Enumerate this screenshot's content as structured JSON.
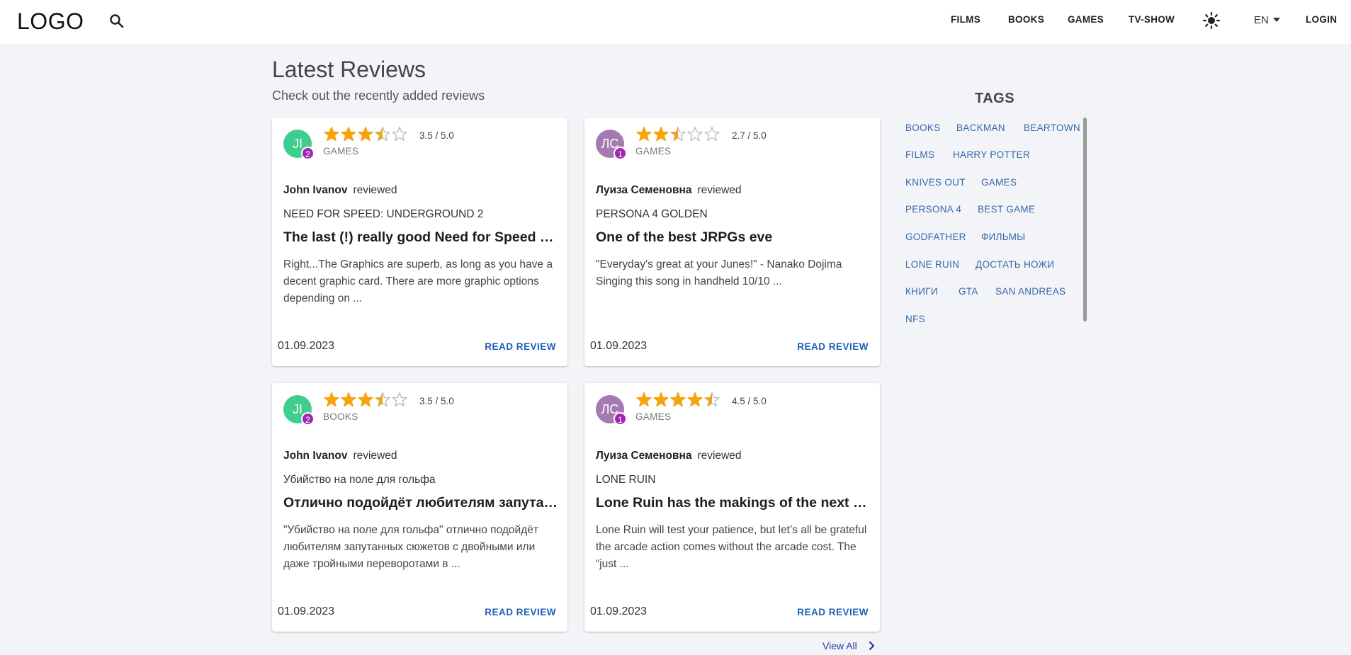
{
  "header": {
    "logo": "LOGO",
    "nav": [
      "FILMS",
      "BOOKS",
      "GAMES",
      "TV-SHOW"
    ],
    "lang": "EN",
    "login": "LOGIN"
  },
  "main": {
    "title": "Latest Reviews",
    "subtitle": "Check out the recently added reviews",
    "reviewed_word": "reviewed",
    "read_review_label": "READ REVIEW",
    "view_all": "View All"
  },
  "reviews": [
    {
      "initials": "JI",
      "avatar_color": "#3ecf8e",
      "badge": "2",
      "rating_value": 3.5,
      "rating_text": "3.5 / 5.0",
      "category": "GAMES",
      "author": "John Ivanov",
      "work": "NEED FOR SPEED: UNDERGROUND 2",
      "title": "The last (!) really good Need for Speed game",
      "excerpt": "Right...The Graphics are superb, as long as you have a decent graphic card. There are more graphic options depending on ...",
      "date": "01.09.2023"
    },
    {
      "initials": "ЛС",
      "avatar_color": "#a47ab0",
      "badge": "1",
      "rating_value": 2.7,
      "rating_text": "2.7 / 5.0",
      "category": "GAMES",
      "author": "Луиза Семеновна",
      "work": "PERSONA 4 GOLDEN",
      "title": "One of the best JRPGs eve",
      "excerpt": "\"Everyday's great at your Junes!\" - Nanako Dojima Singing this song in handheld 10/10 ...",
      "date": "01.09.2023"
    },
    {
      "initials": "JI",
      "avatar_color": "#3ecf8e",
      "badge": "2",
      "rating_value": 3.5,
      "rating_text": "3.5 / 5.0",
      "category": "BOOKS",
      "author": "John Ivanov",
      "work": "Убийство на поле для гольфа",
      "title": "Отлично подойдёт любителям запутанных сюжетов",
      "excerpt": "\"Убийство на поле для гольфа\" отлично подойдёт любителям запутанных сюжетов с двойными или даже тройными переворотами в ...",
      "date": "01.09.2023"
    },
    {
      "initials": "ЛС",
      "avatar_color": "#a47ab0",
      "badge": "1",
      "rating_value": 4.5,
      "rating_text": "4.5 / 5.0",
      "category": "GAMES",
      "author": "Луиза Семеновна",
      "work": "LONE RUIN",
      "title": "Lone Ruin has the makings of the next great roguelike",
      "excerpt": "Lone Ruin will test your patience, but let’s all be grateful the arcade action comes without the arcade cost. The “just ...",
      "date": "01.09.2023"
    }
  ],
  "tags": {
    "title": "TAGS",
    "items": [
      "BOOKS",
      "BACKMAN",
      "BEARTOWN",
      "FILMS",
      "HARRY POTTER",
      "KNIVES OUT",
      "GAMES",
      "PERSONA 4",
      "BEST GAME",
      "GODFATHER",
      "ФИЛЬМЫ",
      "LONE RUIN",
      "ДОСТАТЬ НОЖИ",
      "КНИГИ",
      "GTA",
      "SAN ANDREAS",
      "NFS"
    ]
  },
  "colors": {
    "star_filled": "#f5a40c",
    "star_empty": "#bdbdbd",
    "link": "#1e5fb4",
    "badge": "#9c27b0"
  },
  "icons": {
    "search": "search-icon",
    "theme": "sun-icon",
    "lang_caret": "caret-down-icon",
    "view_all": "chevron-right-icon"
  }
}
